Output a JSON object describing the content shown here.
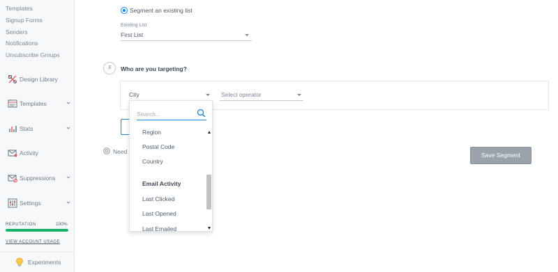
{
  "sidebar": {
    "sublinks": [
      "Templates",
      "Signup Forms",
      "Senders",
      "Notifications",
      "Unsubscribe Groups"
    ],
    "nav": [
      {
        "label": "Design Library",
        "icon": "design-library-icon"
      },
      {
        "label": "Templates",
        "icon": "templates-icon"
      },
      {
        "label": "Stats",
        "icon": "stats-icon"
      },
      {
        "label": "Activity",
        "icon": "activity-icon"
      },
      {
        "label": "Suppressions",
        "icon": "suppressions-icon"
      },
      {
        "label": "Settings",
        "icon": "settings-icon"
      }
    ],
    "reputation": {
      "label": "REPUTATION",
      "value": "100%",
      "fraction": 1.0,
      "color": "#17b26a"
    },
    "view_usage": "VIEW ACCOUNT USAGE",
    "experiments": "Experiments"
  },
  "segment": {
    "radio_label": "Segment an existing list",
    "existing_list_label": "Existing List",
    "existing_list_value": "First List"
  },
  "targeting": {
    "step_number": "3",
    "title": "Who are you targeting?",
    "field_value": "City",
    "operator_placeholder": "Select operator"
  },
  "dropdown": {
    "search_placeholder": "Search...",
    "options": [
      "Region",
      "Postal Code",
      "Country"
    ],
    "group_label": "Email Activity",
    "group_options": [
      "Last Clicked",
      "Last Opened",
      "Last Emailed"
    ]
  },
  "help_text": "Need h",
  "save_button": "Save Segment",
  "colors": {
    "accent": "#1a82e2",
    "save_button": "#9aa3ac"
  }
}
